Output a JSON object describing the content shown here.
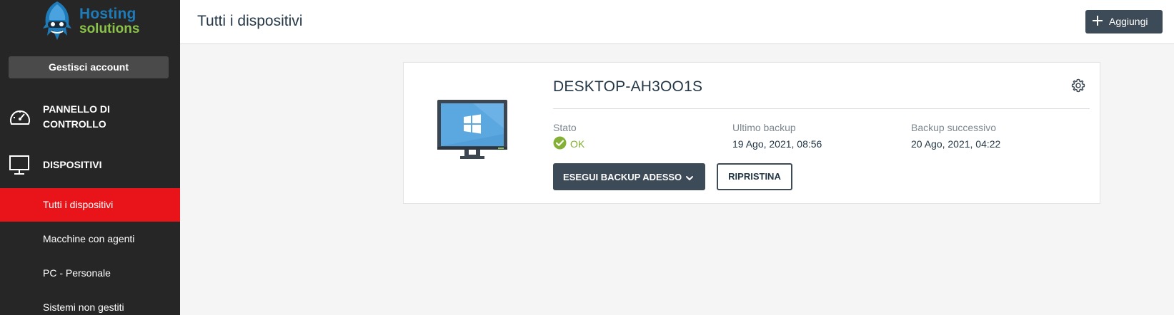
{
  "brand": {
    "line1": "Hosting",
    "line2": "solutions",
    "color_primary": "#1f7bb8",
    "color_secondary": "#8bc34a"
  },
  "sidebar": {
    "manage_account": "Gestisci account",
    "sections": [
      {
        "label": "PANNELLO DI CONTROLLO",
        "icon": "speedometer-icon"
      },
      {
        "label": "DISPOSITIVI",
        "icon": "monitor-icon"
      }
    ],
    "sub_items": [
      {
        "label": "Tutti i dispositivi",
        "active": true
      },
      {
        "label": "Macchine con agenti",
        "active": false
      },
      {
        "label": "PC - Personale",
        "active": false
      },
      {
        "label": "Sistemi non gestiti",
        "active": false
      }
    ],
    "active_color": "#e8141a"
  },
  "header": {
    "title": "Tutti i dispositivi",
    "add_button": "Aggiungi",
    "add_icon": "plus-icon"
  },
  "device": {
    "name": "DESKTOP-AH3OO1S",
    "os_icon": "windows-icon",
    "settings_icon": "gear-icon",
    "status_label": "Stato",
    "status_value": "OK",
    "status_color": "#84b135",
    "last_backup_label": "Ultimo backup",
    "last_backup_value": "19 Ago, 2021, 08:56",
    "next_backup_label": "Backup successivo",
    "next_backup_value": "20 Ago, 2021, 04:22",
    "backup_now_button": "ESEGUI BACKUP ADESSO",
    "restore_button": "RIPRISTINA"
  }
}
